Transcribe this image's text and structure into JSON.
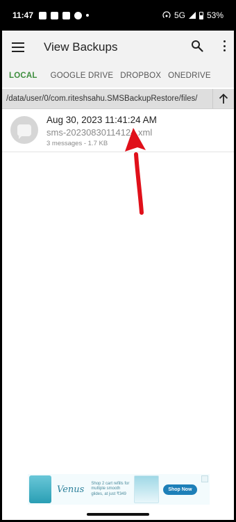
{
  "status_bar": {
    "time": "11:47",
    "network": "5G",
    "battery": "53%"
  },
  "app_bar": {
    "title": "View Backups"
  },
  "tabs": [
    {
      "label": "LOCAL",
      "active": true
    },
    {
      "label": "GOOGLE DRIVE",
      "active": false
    },
    {
      "label": "DROPBOX",
      "active": false
    },
    {
      "label": "ONEDRIVE",
      "active": false
    }
  ],
  "path_bar": {
    "path": "/data/user/0/com.riteshsahu.SMSBackupRestore/files/"
  },
  "backups": [
    {
      "date": "Aug 30, 2023 11:41:24 AM",
      "filename": "sms-20230830114124.xml",
      "meta": "3 messages - 1.7 KB"
    }
  ],
  "ad": {
    "brand": "Venus",
    "copy": "Shop 2 cart refills for multiple smooth glides, at just ₹349",
    "cta": "Shop Now"
  },
  "colors": {
    "accent": "#3e8e3e",
    "annotation_arrow": "#e0101a",
    "app_bar_bg": "#f2f2f2"
  }
}
